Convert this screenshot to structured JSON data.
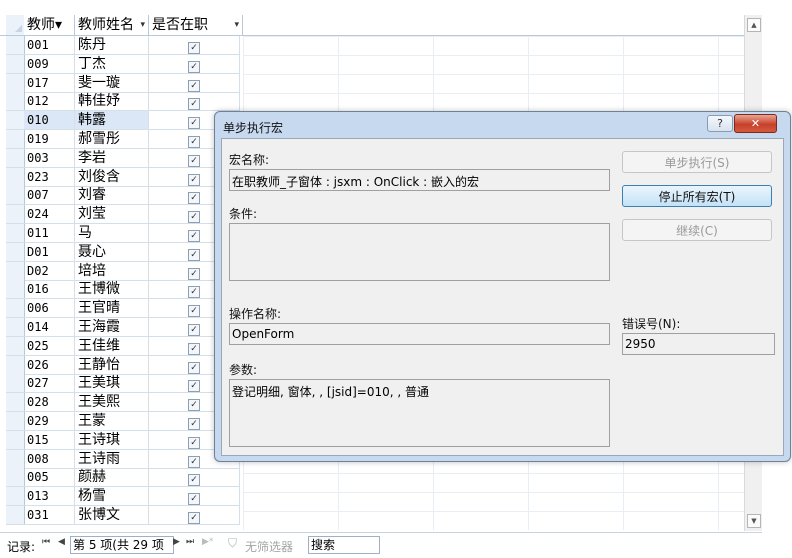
{
  "datasheet": {
    "columns": [
      {
        "label": "教师▾",
        "arrow": "▾"
      },
      {
        "label": "教师姓名",
        "arrow": "▾"
      },
      {
        "label": "是否在职",
        "arrow": "▾"
      }
    ],
    "rows": [
      {
        "id": "001",
        "name": "陈丹",
        "active": true
      },
      {
        "id": "009",
        "name": "丁杰",
        "active": true
      },
      {
        "id": "017",
        "name": "斐一璇",
        "active": true
      },
      {
        "id": "012",
        "name": "韩佳妤",
        "active": true
      },
      {
        "id": "010",
        "name": "韩露",
        "active": true,
        "selected": true
      },
      {
        "id": "019",
        "name": "郝雪彤",
        "active": true
      },
      {
        "id": "003",
        "name": "李岩",
        "active": true
      },
      {
        "id": "023",
        "name": "刘俊含",
        "active": true
      },
      {
        "id": "007",
        "name": "刘睿",
        "active": true
      },
      {
        "id": "024",
        "name": "刘莹",
        "active": true
      },
      {
        "id": "011",
        "name": "马",
        "active": true
      },
      {
        "id": "D01",
        "name": "聂心",
        "active": true
      },
      {
        "id": "D02",
        "name": "培培",
        "active": true
      },
      {
        "id": "016",
        "name": "王博微",
        "active": true
      },
      {
        "id": "006",
        "name": "王官晴",
        "active": true
      },
      {
        "id": "014",
        "name": "王海霞",
        "active": true
      },
      {
        "id": "025",
        "name": "王佳维",
        "active": true
      },
      {
        "id": "026",
        "name": "王静怡",
        "active": true
      },
      {
        "id": "027",
        "name": "王美琪",
        "active": true
      },
      {
        "id": "028",
        "name": "王美熙",
        "active": true
      },
      {
        "id": "029",
        "name": "王蒙",
        "active": true
      },
      {
        "id": "015",
        "name": "王诗琪",
        "active": true
      },
      {
        "id": "008",
        "name": "王诗雨",
        "active": true
      },
      {
        "id": "005",
        "name": "颜赫",
        "active": true
      },
      {
        "id": "013",
        "name": "杨雪",
        "active": true
      },
      {
        "id": "031",
        "name": "张博文",
        "active": true
      }
    ],
    "check_glyph": "✓"
  },
  "navbar": {
    "label": "记录:",
    "first": "⏮",
    "prev": "◀",
    "record": "第 5 项(共 29 项",
    "next": "▶",
    "last": "⏭",
    "new": "▶*",
    "filter": "无筛选器",
    "search": "搜索"
  },
  "dialog": {
    "title": "单步执行宏",
    "help": "?",
    "close": "✕",
    "macro_name_label": "宏名称:",
    "macro_name_value": "在职教师_子窗体 : jsxm : OnClick : 嵌入的宏",
    "condition_label": "条件:",
    "condition_value": "",
    "action_label": "操作名称:",
    "action_value": "OpenForm",
    "args_label": "参数:",
    "args_value": "登记明细, 窗体, , [jsid]=010, , 普通",
    "error_label": "错误号(N):",
    "error_value": "2950",
    "btn_step": "单步执行(S)",
    "btn_stop": "停止所有宏(T)",
    "btn_continue": "继续(C)"
  },
  "scrollbar": {
    "up": "▲",
    "down": "▼"
  }
}
